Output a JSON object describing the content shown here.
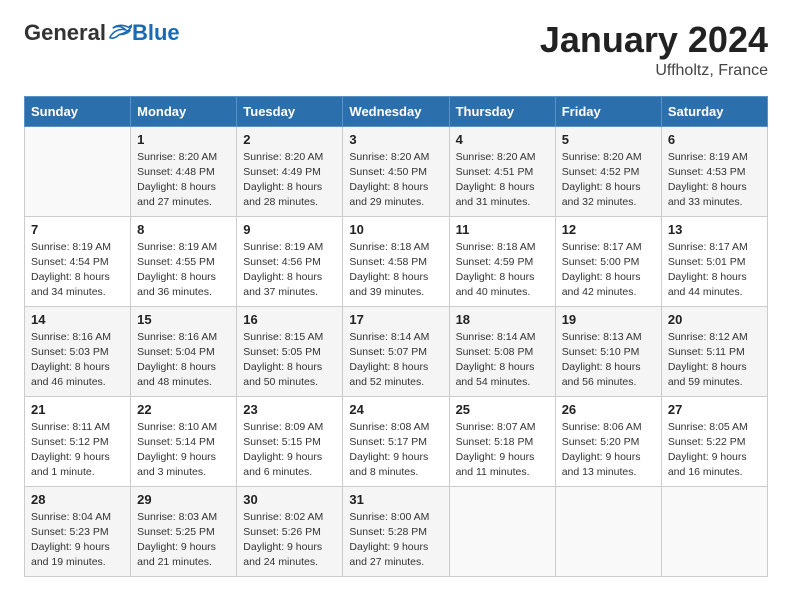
{
  "header": {
    "logo": {
      "general": "General",
      "blue": "Blue"
    },
    "title": "January 2024",
    "location": "Uffholtz, France"
  },
  "weekdays": [
    "Sunday",
    "Monday",
    "Tuesday",
    "Wednesday",
    "Thursday",
    "Friday",
    "Saturday"
  ],
  "weeks": [
    [
      {
        "day": "",
        "sunrise": "",
        "sunset": "",
        "daylight": ""
      },
      {
        "day": "1",
        "sunrise": "Sunrise: 8:20 AM",
        "sunset": "Sunset: 4:48 PM",
        "daylight": "Daylight: 8 hours and 27 minutes."
      },
      {
        "day": "2",
        "sunrise": "Sunrise: 8:20 AM",
        "sunset": "Sunset: 4:49 PM",
        "daylight": "Daylight: 8 hours and 28 minutes."
      },
      {
        "day": "3",
        "sunrise": "Sunrise: 8:20 AM",
        "sunset": "Sunset: 4:50 PM",
        "daylight": "Daylight: 8 hours and 29 minutes."
      },
      {
        "day": "4",
        "sunrise": "Sunrise: 8:20 AM",
        "sunset": "Sunset: 4:51 PM",
        "daylight": "Daylight: 8 hours and 31 minutes."
      },
      {
        "day": "5",
        "sunrise": "Sunrise: 8:20 AM",
        "sunset": "Sunset: 4:52 PM",
        "daylight": "Daylight: 8 hours and 32 minutes."
      },
      {
        "day": "6",
        "sunrise": "Sunrise: 8:19 AM",
        "sunset": "Sunset: 4:53 PM",
        "daylight": "Daylight: 8 hours and 33 minutes."
      }
    ],
    [
      {
        "day": "7",
        "sunrise": "Sunrise: 8:19 AM",
        "sunset": "Sunset: 4:54 PM",
        "daylight": "Daylight: 8 hours and 34 minutes."
      },
      {
        "day": "8",
        "sunrise": "Sunrise: 8:19 AM",
        "sunset": "Sunset: 4:55 PM",
        "daylight": "Daylight: 8 hours and 36 minutes."
      },
      {
        "day": "9",
        "sunrise": "Sunrise: 8:19 AM",
        "sunset": "Sunset: 4:56 PM",
        "daylight": "Daylight: 8 hours and 37 minutes."
      },
      {
        "day": "10",
        "sunrise": "Sunrise: 8:18 AM",
        "sunset": "Sunset: 4:58 PM",
        "daylight": "Daylight: 8 hours and 39 minutes."
      },
      {
        "day": "11",
        "sunrise": "Sunrise: 8:18 AM",
        "sunset": "Sunset: 4:59 PM",
        "daylight": "Daylight: 8 hours and 40 minutes."
      },
      {
        "day": "12",
        "sunrise": "Sunrise: 8:17 AM",
        "sunset": "Sunset: 5:00 PM",
        "daylight": "Daylight: 8 hours and 42 minutes."
      },
      {
        "day": "13",
        "sunrise": "Sunrise: 8:17 AM",
        "sunset": "Sunset: 5:01 PM",
        "daylight": "Daylight: 8 hours and 44 minutes."
      }
    ],
    [
      {
        "day": "14",
        "sunrise": "Sunrise: 8:16 AM",
        "sunset": "Sunset: 5:03 PM",
        "daylight": "Daylight: 8 hours and 46 minutes."
      },
      {
        "day": "15",
        "sunrise": "Sunrise: 8:16 AM",
        "sunset": "Sunset: 5:04 PM",
        "daylight": "Daylight: 8 hours and 48 minutes."
      },
      {
        "day": "16",
        "sunrise": "Sunrise: 8:15 AM",
        "sunset": "Sunset: 5:05 PM",
        "daylight": "Daylight: 8 hours and 50 minutes."
      },
      {
        "day": "17",
        "sunrise": "Sunrise: 8:14 AM",
        "sunset": "Sunset: 5:07 PM",
        "daylight": "Daylight: 8 hours and 52 minutes."
      },
      {
        "day": "18",
        "sunrise": "Sunrise: 8:14 AM",
        "sunset": "Sunset: 5:08 PM",
        "daylight": "Daylight: 8 hours and 54 minutes."
      },
      {
        "day": "19",
        "sunrise": "Sunrise: 8:13 AM",
        "sunset": "Sunset: 5:10 PM",
        "daylight": "Daylight: 8 hours and 56 minutes."
      },
      {
        "day": "20",
        "sunrise": "Sunrise: 8:12 AM",
        "sunset": "Sunset: 5:11 PM",
        "daylight": "Daylight: 8 hours and 59 minutes."
      }
    ],
    [
      {
        "day": "21",
        "sunrise": "Sunrise: 8:11 AM",
        "sunset": "Sunset: 5:12 PM",
        "daylight": "Daylight: 9 hours and 1 minute."
      },
      {
        "day": "22",
        "sunrise": "Sunrise: 8:10 AM",
        "sunset": "Sunset: 5:14 PM",
        "daylight": "Daylight: 9 hours and 3 minutes."
      },
      {
        "day": "23",
        "sunrise": "Sunrise: 8:09 AM",
        "sunset": "Sunset: 5:15 PM",
        "daylight": "Daylight: 9 hours and 6 minutes."
      },
      {
        "day": "24",
        "sunrise": "Sunrise: 8:08 AM",
        "sunset": "Sunset: 5:17 PM",
        "daylight": "Daylight: 9 hours and 8 minutes."
      },
      {
        "day": "25",
        "sunrise": "Sunrise: 8:07 AM",
        "sunset": "Sunset: 5:18 PM",
        "daylight": "Daylight: 9 hours and 11 minutes."
      },
      {
        "day": "26",
        "sunrise": "Sunrise: 8:06 AM",
        "sunset": "Sunset: 5:20 PM",
        "daylight": "Daylight: 9 hours and 13 minutes."
      },
      {
        "day": "27",
        "sunrise": "Sunrise: 8:05 AM",
        "sunset": "Sunset: 5:22 PM",
        "daylight": "Daylight: 9 hours and 16 minutes."
      }
    ],
    [
      {
        "day": "28",
        "sunrise": "Sunrise: 8:04 AM",
        "sunset": "Sunset: 5:23 PM",
        "daylight": "Daylight: 9 hours and 19 minutes."
      },
      {
        "day": "29",
        "sunrise": "Sunrise: 8:03 AM",
        "sunset": "Sunset: 5:25 PM",
        "daylight": "Daylight: 9 hours and 21 minutes."
      },
      {
        "day": "30",
        "sunrise": "Sunrise: 8:02 AM",
        "sunset": "Sunset: 5:26 PM",
        "daylight": "Daylight: 9 hours and 24 minutes."
      },
      {
        "day": "31",
        "sunrise": "Sunrise: 8:00 AM",
        "sunset": "Sunset: 5:28 PM",
        "daylight": "Daylight: 9 hours and 27 minutes."
      },
      {
        "day": "",
        "sunrise": "",
        "sunset": "",
        "daylight": ""
      },
      {
        "day": "",
        "sunrise": "",
        "sunset": "",
        "daylight": ""
      },
      {
        "day": "",
        "sunrise": "",
        "sunset": "",
        "daylight": ""
      }
    ]
  ]
}
